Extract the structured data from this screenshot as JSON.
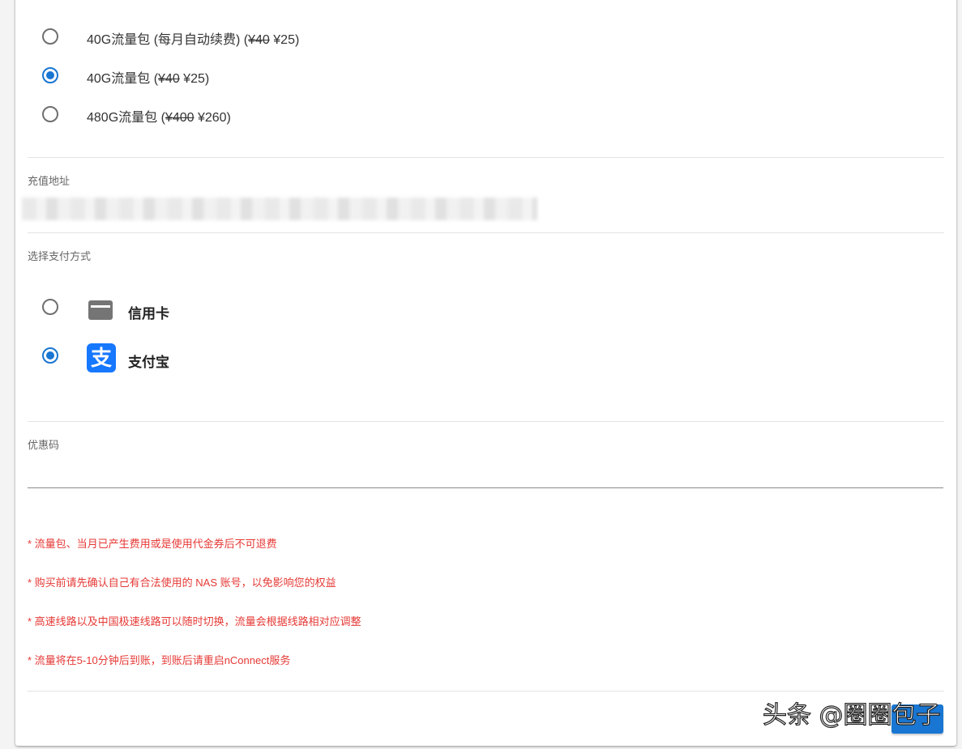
{
  "plans": [
    {
      "name": "40G流量包 (每月自动续费) (",
      "old_price": "¥40",
      "new_price": " ¥25)",
      "selected": false
    },
    {
      "name": "40G流量包 (",
      "old_price": "¥40",
      "new_price": " ¥25)",
      "selected": true
    },
    {
      "name": "480G流量包 (",
      "old_price": "¥400",
      "new_price": " ¥260)",
      "selected": false
    }
  ],
  "recharge": {
    "label": "充值地址"
  },
  "payment": {
    "label": "选择支付方式",
    "methods": [
      {
        "name": "信用卡",
        "icon": "credit-card-icon",
        "selected": false
      },
      {
        "name": "支付宝",
        "icon": "alipay-icon",
        "icon_glyph": "支",
        "selected": true
      }
    ]
  },
  "coupon": {
    "label": "优惠码",
    "value": ""
  },
  "notes": [
    "* 流量包、当月已产生费用或是使用代金券后不可退费",
    "* 购买前请先确认自己有合法使用的 NAS 账号，以免影响您的权益",
    "* 高速线路以及中国极速线路可以随时切换，流量会根据线路相对应调整",
    "* 流量将在5-10分钟后到账，到账后请重启nConnect服务"
  ],
  "watermark": "头条 @圈圈包子",
  "colors": {
    "accent": "#1976d2",
    "warning_text": "#e53935",
    "alipay": "#1677ff"
  }
}
